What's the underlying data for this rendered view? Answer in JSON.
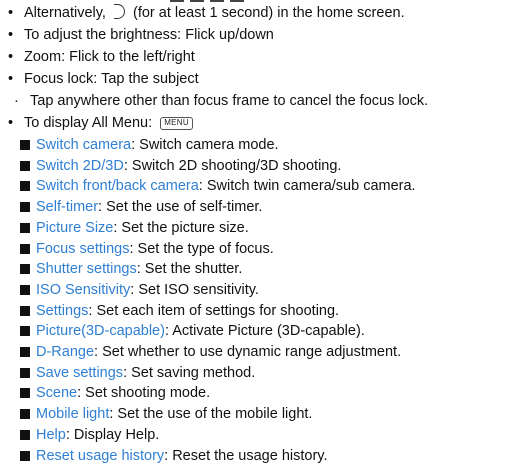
{
  "lines": {
    "alt": {
      "before": "Alternatively, ",
      "after": " (for at least 1 second) in the home screen."
    },
    "brightness": "To adjust the brightness: Flick up/down",
    "zoom": "Zoom: Flick to the left/right",
    "focus_lock": "Focus lock: Tap the subject",
    "cancel_focus": "Tap anywhere other than focus frame to cancel the focus lock.",
    "all_menu": {
      "text": "To display All Menu: ",
      "key_label": "MENU"
    }
  },
  "menu_items": [
    {
      "term": "Switch camera",
      "desc": ": Switch camera mode."
    },
    {
      "term": "Switch 2D/3D",
      "desc": ": Switch 2D shooting/3D shooting."
    },
    {
      "term": "Switch front/back camera",
      "desc": ": Switch twin camera/sub camera."
    },
    {
      "term": "Self-timer",
      "desc": ": Set the use of self-timer."
    },
    {
      "term": "Picture Size",
      "desc": ": Set the picture size."
    },
    {
      "term": "Focus settings",
      "desc": ": Set the type of focus."
    },
    {
      "term": "Shutter settings",
      "desc": ": Set the shutter."
    },
    {
      "term": "ISO Sensitivity",
      "desc": ": Set ISO sensitivity."
    },
    {
      "term": "Settings",
      "desc": ": Set each item of settings for shooting."
    },
    {
      "term": "Picture(3D-capable)",
      "desc": ": Activate Picture (3D-capable)."
    },
    {
      "term": "D-Range",
      "desc": ": Set whether to use dynamic range adjustment."
    },
    {
      "term": "Save settings",
      "desc": ": Set saving method."
    },
    {
      "term": "Scene",
      "desc": ": Set shooting mode."
    },
    {
      "term": "Mobile light",
      "desc": ": Set the use of the mobile light."
    },
    {
      "term": "Help",
      "desc": ": Display Help."
    },
    {
      "term": "Reset usage history",
      "desc": ": Reset the usage history."
    }
  ],
  "colors": {
    "link": "#2f7fd3",
    "text": "#111111"
  }
}
